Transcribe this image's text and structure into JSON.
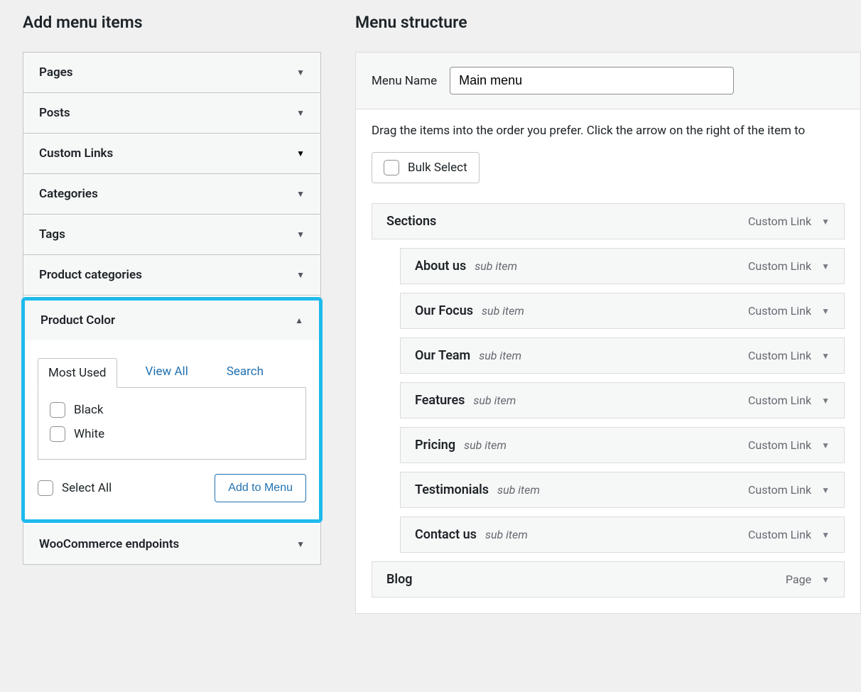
{
  "left": {
    "title": "Add menu items",
    "panels": [
      {
        "label": "Pages",
        "expanded": false
      },
      {
        "label": "Posts",
        "expanded": false
      },
      {
        "label": "Custom Links",
        "expanded": false,
        "darkArrow": true
      },
      {
        "label": "Categories",
        "expanded": false
      },
      {
        "label": "Tags",
        "expanded": false
      },
      {
        "label": "Product categories",
        "expanded": false
      },
      {
        "label": "Product Color",
        "expanded": true
      },
      {
        "label": "WooCommerce endpoints",
        "expanded": false
      }
    ],
    "productColor": {
      "tabs": {
        "mostUsed": "Most Used",
        "viewAll": "View All",
        "search": "Search"
      },
      "activeTab": "mostUsed",
      "options": [
        {
          "label": "Black"
        },
        {
          "label": "White"
        }
      ],
      "selectAll": "Select All",
      "addToMenu": "Add to Menu"
    }
  },
  "right": {
    "title": "Menu structure",
    "menuNameLabel": "Menu Name",
    "menuNameValue": "Main menu",
    "helpText": "Drag the items into the order you prefer. Click the arrow on the right of the item to",
    "bulkSelect": "Bulk Select",
    "subItemLabel": "sub item",
    "items": [
      {
        "title": "Sections",
        "type": "Custom Link",
        "sub": false
      },
      {
        "title": "About us",
        "type": "Custom Link",
        "sub": true
      },
      {
        "title": "Our Focus",
        "type": "Custom Link",
        "sub": true
      },
      {
        "title": "Our Team",
        "type": "Custom Link",
        "sub": true
      },
      {
        "title": "Features",
        "type": "Custom Link",
        "sub": true
      },
      {
        "title": "Pricing",
        "type": "Custom Link",
        "sub": true
      },
      {
        "title": "Testimonials",
        "type": "Custom Link",
        "sub": true
      },
      {
        "title": "Contact us",
        "type": "Custom Link",
        "sub": true
      },
      {
        "title": "Blog",
        "type": "Page",
        "sub": false
      }
    ]
  }
}
